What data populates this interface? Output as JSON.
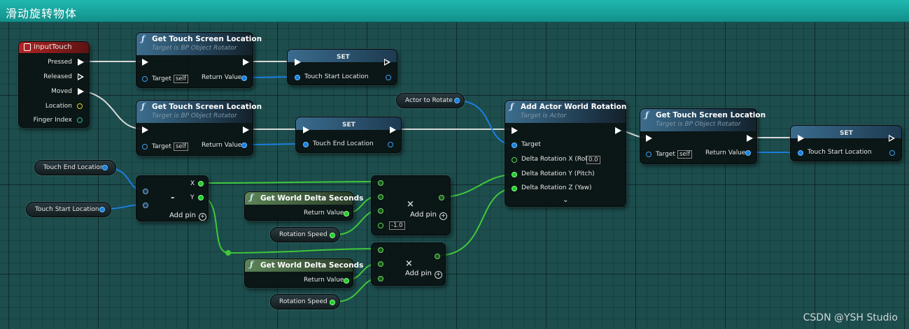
{
  "window": {
    "title": "滑动旋转物体"
  },
  "watermark": "CSDN @YSH Studio",
  "colors": {
    "titlebar": "#18a7a0",
    "background": "#1d4d4d",
    "exec_wire": "#d8d8d8",
    "object_wire": "#1a7fe0",
    "float_wire": "#3fc83a",
    "vector_wire": "#f0d010"
  },
  "nodes": {
    "input_touch": {
      "title": "InputTouch",
      "pins": [
        "Pressed",
        "Released",
        "Moved",
        "Location",
        "Finger Index"
      ]
    },
    "get_touch_1": {
      "title": "Get Touch Screen Location",
      "subtitle": "Target is BP Object Rotator",
      "target_label": "Target",
      "self_label": "self",
      "return_label": "Return Value"
    },
    "set_1": {
      "title": "SET",
      "pin_label": "Touch Start Location"
    },
    "get_touch_2": {
      "title": "Get Touch Screen Location",
      "subtitle": "Target is BP Object Rotator",
      "target_label": "Target",
      "self_label": "self",
      "return_label": "Return Value"
    },
    "set_2": {
      "title": "SET",
      "pin_label": "Touch End Location"
    },
    "actor_to_rotate": {
      "label": "Actor to Rotate"
    },
    "add_rotation": {
      "title": "Add Actor World Rotation",
      "subtitle": "Target is Actor",
      "target_label": "Target",
      "roll_label": "Delta Rotation X (Roll)",
      "roll_value": "0.0",
      "pitch_label": "Delta Rotation Y (Pitch)",
      "yaw_label": "Delta Rotation Z (Yaw)",
      "expand_icon": "chevron-down-icon"
    },
    "get_touch_3": {
      "title": "Get Touch Screen Location",
      "subtitle": "Target is BP Object Rotator",
      "target_label": "Target",
      "self_label": "self",
      "return_label": "Return Value"
    },
    "set_3": {
      "title": "SET",
      "pin_label": "Touch Start Location"
    },
    "touch_end_var": {
      "label": "Touch End Location"
    },
    "touch_start_var": {
      "label": "Touch Start Location"
    },
    "subtract": {
      "op": "-",
      "x_label": "X",
      "y_label": "Y",
      "add_pin": "Add pin"
    },
    "delta_1": {
      "title": "Get World Delta Seconds",
      "return_label": "Return Value"
    },
    "speed_1": {
      "label": "Rotation Speed"
    },
    "multiply_1": {
      "op": "×",
      "add_pin": "Add pin",
      "const_value": "-1.0"
    },
    "delta_2": {
      "title": "Get World Delta Seconds",
      "return_label": "Return Value"
    },
    "speed_2": {
      "label": "Rotation Speed"
    },
    "multiply_2": {
      "op": "×",
      "add_pin": "Add pin"
    }
  }
}
